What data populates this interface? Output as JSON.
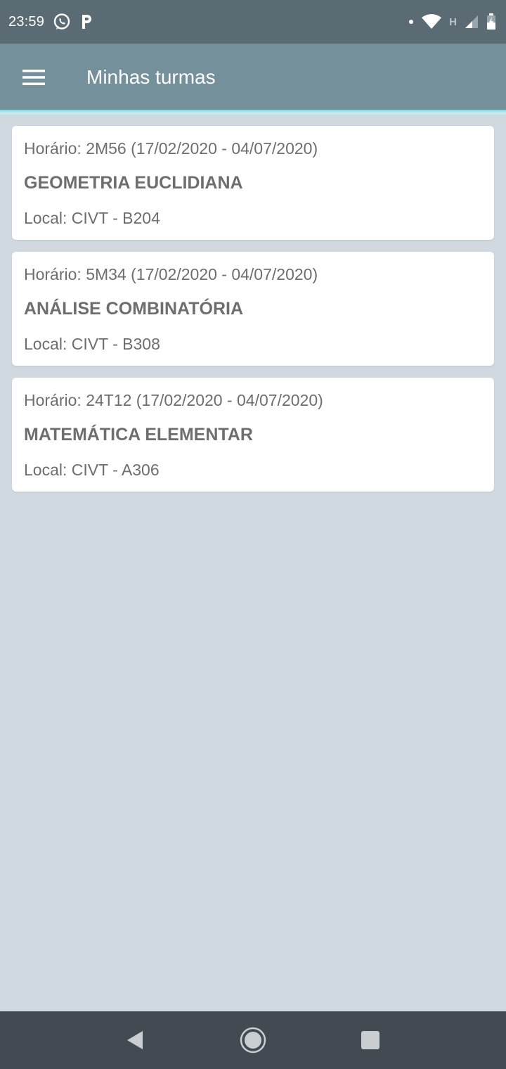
{
  "status_bar": {
    "time": "23:59",
    "left_icons": [
      "whatsapp-icon",
      "parking-p-icon"
    ],
    "right_icons": [
      "notification-dot-icon",
      "wifi-icon",
      "network-h-icon",
      "signal-icon",
      "battery-charging-icon"
    ],
    "network_label": "H"
  },
  "app_bar": {
    "title": "Minhas turmas",
    "color": "#74919b",
    "accent": "#7fd6e0"
  },
  "classes": [
    {
      "schedule": "Horário: 2M56 (17/02/2020 - 04/07/2020)",
      "name": "GEOMETRIA EUCLIDIANA",
      "location": "Local: CIVT - B204"
    },
    {
      "schedule": "Horário: 5M34 (17/02/2020 - 04/07/2020)",
      "name": "ANÁLISE COMBINATÓRIA",
      "location": "Local: CIVT - B308"
    },
    {
      "schedule": "Horário: 24T12 (17/02/2020 - 04/07/2020)",
      "name": "MATEMÁTICA ELEMENTAR",
      "location": "Local: CIVT - A306"
    }
  ],
  "nav_bar": {
    "buttons": [
      "back-icon",
      "home-icon",
      "recents-icon"
    ]
  }
}
